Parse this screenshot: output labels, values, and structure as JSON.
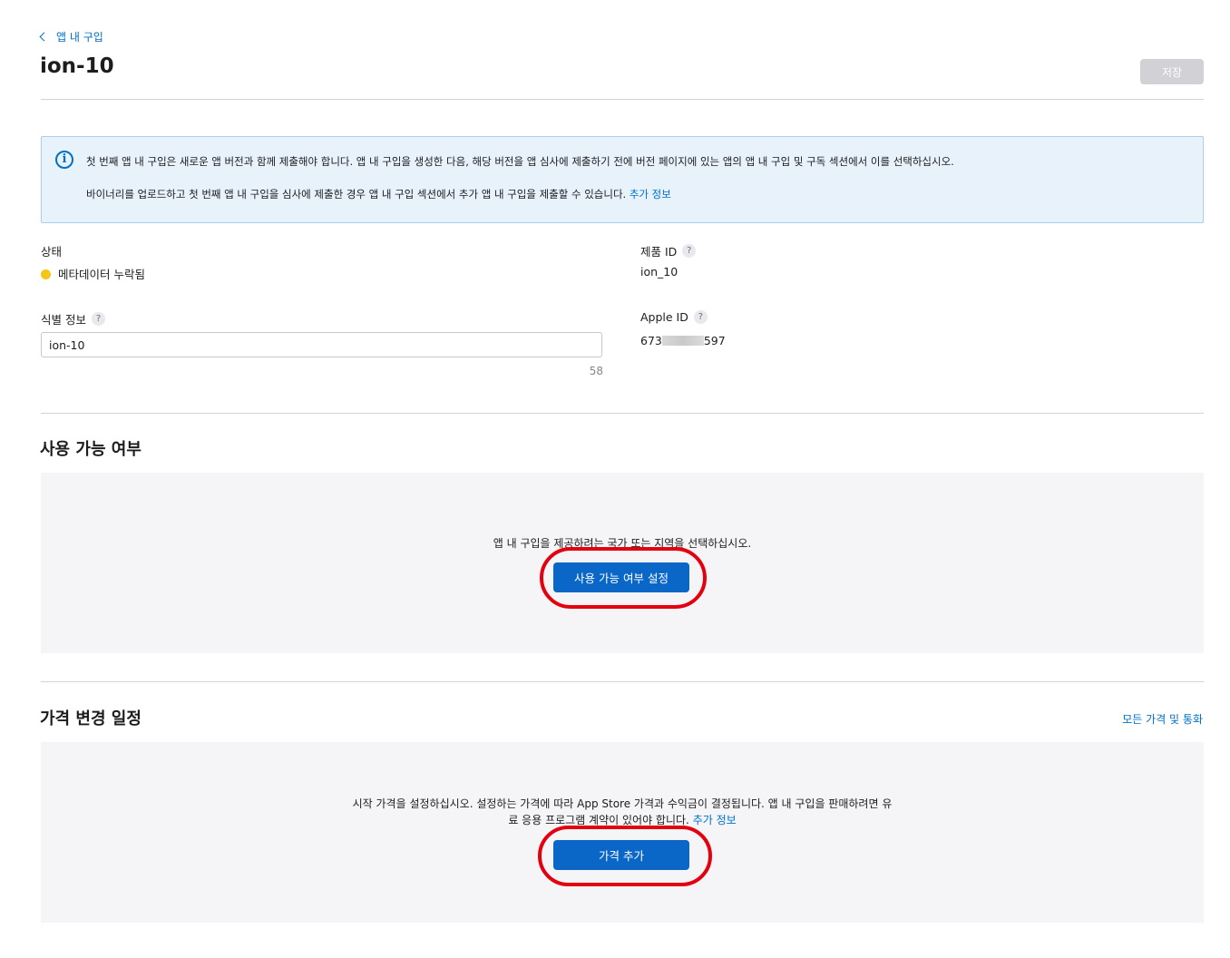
{
  "header": {
    "back_label": "앱 내 구입",
    "title": "ion-10",
    "save_label": "저장"
  },
  "info": {
    "line1": "첫 번째 앱 내 구입은 새로운 앱 버전과 함께 제출해야 합니다. 앱 내 구입을 생성한 다음, 해당 버전을 앱 심사에 제출하기 전에 버전 페이지에 있는 앱의 앱 내 구입 및 구독 섹션에서 이를 선택하십시오.",
    "line2": "바이너리를 업로드하고 첫 번째 앱 내 구입을 심사에 제출한 경우 앱 내 구입 섹션에서 추가 앱 내 구입을 제출할 수 있습니다.",
    "learn_more": "추가 정보"
  },
  "fields": {
    "status_label": "상태",
    "status_value": "메타데이터 누락됨",
    "status_color": "#f5c518",
    "product_id_label": "제품 ID",
    "product_id_value": "ion_10",
    "reference_label": "식별 정보",
    "reference_value": "ion-10",
    "char_remaining": "58",
    "apple_id_label": "Apple ID",
    "apple_id_prefix": "673",
    "apple_id_suffix": "597",
    "help_glyph": "?"
  },
  "availability": {
    "title": "사용 가능 여부",
    "message": "앱 내 구입을 제공하려는 국가 또는 지역을 선택하십시오.",
    "button_label": "사용 가능 여부 설정"
  },
  "pricing": {
    "title": "가격 변경 일정",
    "all_prices_link": "모든 가격 및 통화",
    "message_line1": "시작 가격을 설정하십시오. 설정하는 가격에 따라 App Store 가격과 수익금이 결정됩니다. 앱 내 구입을 판매하려면 유",
    "message_line2": "료 응용 프로그램 계약이 있어야 합니다.",
    "learn_more": "추가 정보",
    "button_label": "가격 추가"
  },
  "colors": {
    "accent": "#0070c9",
    "primary_button": "#0a67c7",
    "highlight_ring": "#e3000f"
  }
}
